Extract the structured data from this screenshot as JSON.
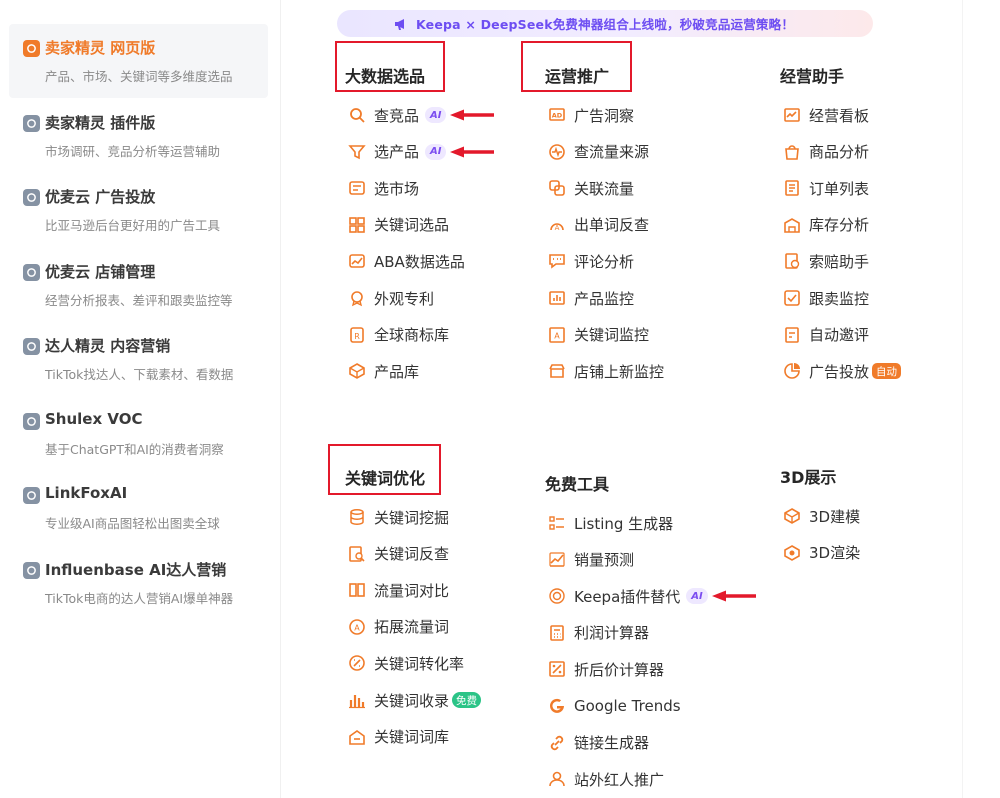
{
  "colors": {
    "accent": "#f07b2a",
    "annotation_red": "#e3192b",
    "ai_purple": "#7b4df0",
    "free_green": "#2bc487"
  },
  "sidebar": {
    "items": [
      {
        "title": "卖家精灵 网页版",
        "desc": "产品、市场、关键词等多维度选品",
        "icon": "sellersprite-web-icon",
        "active": true
      },
      {
        "title": "卖家精灵 插件版",
        "desc": "市场调研、竞品分析等运营辅助",
        "icon": "sellersprite-plugin-icon",
        "active": false
      },
      {
        "title": "优麦云 广告投放",
        "desc": "比亚马逊后台更好用的广告工具",
        "icon": "umy-ads-icon",
        "active": false
      },
      {
        "title": "优麦云 店铺管理",
        "desc": "经营分析报表、差评和跟卖监控等",
        "icon": "umy-store-icon",
        "active": false
      },
      {
        "title": "达人精灵 内容营销",
        "desc": "TikTok找达人、下载素材、看数据",
        "icon": "influencer-icon",
        "active": false
      },
      {
        "title": "Shulex VOC",
        "desc": "基于ChatGPT和AI的消费者洞察",
        "icon": "shulex-icon",
        "active": false
      },
      {
        "title": "LinkFoxAI",
        "desc": "专业级AI商品图轻松出图卖全球",
        "icon": "linkfox-icon",
        "active": false
      },
      {
        "title": "Influenbase AI达人营销",
        "desc": "TikTok电商的达人营销AI爆单神器",
        "icon": "influenbase-icon",
        "active": false
      }
    ]
  },
  "banner": {
    "text": "Keepa × DeepSeek免费神器组合上线啦，秒破竞品运营策略！",
    "icon": "megaphone-icon"
  },
  "badges": {
    "ai": "AI",
    "auto": "自动",
    "free": "免费"
  },
  "columns": [
    {
      "title": "大数据选品",
      "items": [
        {
          "label": "查竞品",
          "icon": "search-icon",
          "badge": "ai",
          "arrow": true
        },
        {
          "label": "选产品",
          "icon": "filter-icon",
          "badge": "ai",
          "arrow": true
        },
        {
          "label": "选市场",
          "icon": "market-icon"
        },
        {
          "label": "关键词选品",
          "icon": "grid-icon"
        },
        {
          "label": "ABA数据选品",
          "icon": "trend-chart-icon"
        },
        {
          "label": "外观专利",
          "icon": "patent-icon"
        },
        {
          "label": "全球商标库",
          "icon": "trademark-icon"
        },
        {
          "label": "产品库",
          "icon": "box-icon"
        }
      ]
    },
    {
      "title": "运营推广",
      "items": [
        {
          "label": "广告洞察",
          "icon": "ad-icon"
        },
        {
          "label": "查流量来源",
          "icon": "pulse-icon"
        },
        {
          "label": "关联流量",
          "icon": "link-squares-icon"
        },
        {
          "label": "出单词反查",
          "icon": "reverse-word-icon"
        },
        {
          "label": "评论分析",
          "icon": "comment-icon"
        },
        {
          "label": "产品监控",
          "icon": "bar-monitor-icon"
        },
        {
          "label": "关键词监控",
          "icon": "keyword-monitor-icon"
        },
        {
          "label": "店铺上新监控",
          "icon": "shop-icon"
        }
      ]
    },
    {
      "title": "经营助手",
      "items": [
        {
          "label": "经营看板",
          "icon": "dashboard-icon"
        },
        {
          "label": "商品分析",
          "icon": "bag-icon"
        },
        {
          "label": "订单列表",
          "icon": "order-icon"
        },
        {
          "label": "库存分析",
          "icon": "warehouse-icon"
        },
        {
          "label": "索赔助手",
          "icon": "claim-icon"
        },
        {
          "label": "跟卖监控",
          "icon": "follow-sell-icon"
        },
        {
          "label": "自动邀评",
          "icon": "review-invite-icon"
        },
        {
          "label": "广告投放",
          "icon": "pie-icon",
          "badge": "auto"
        }
      ]
    },
    {
      "title": "关键词优化",
      "items": [
        {
          "label": "关键词挖掘",
          "icon": "database-icon"
        },
        {
          "label": "关键词反查",
          "icon": "doc-search-icon"
        },
        {
          "label": "流量词对比",
          "icon": "compare-icon"
        },
        {
          "label": "拓展流量词",
          "icon": "expand-icon"
        },
        {
          "label": "关键词转化率",
          "icon": "conversion-icon"
        },
        {
          "label": "关键词收录",
          "icon": "bar-chart-icon",
          "badge": "free"
        },
        {
          "label": "关键词词库",
          "icon": "library-icon"
        }
      ]
    },
    {
      "title": "免费工具",
      "items": [
        {
          "label": "Listing 生成器",
          "icon": "list-icon"
        },
        {
          "label": "销量预测",
          "icon": "forecast-icon"
        },
        {
          "label": "Keepa插件替代",
          "icon": "keepa-icon",
          "badge": "ai",
          "arrow": true
        },
        {
          "label": "利润计算器",
          "icon": "calculator-icon"
        },
        {
          "label": "折后价计算器",
          "icon": "discount-icon"
        },
        {
          "label": "Google Trends",
          "icon": "google-icon"
        },
        {
          "label": "链接生成器",
          "icon": "chain-icon"
        },
        {
          "label": "站外红人推广",
          "icon": "person-icon"
        }
      ]
    },
    {
      "title": "3D展示",
      "items": [
        {
          "label": "3D建模",
          "icon": "cube-icon"
        },
        {
          "label": "3D渲染",
          "icon": "render-icon"
        }
      ]
    }
  ]
}
